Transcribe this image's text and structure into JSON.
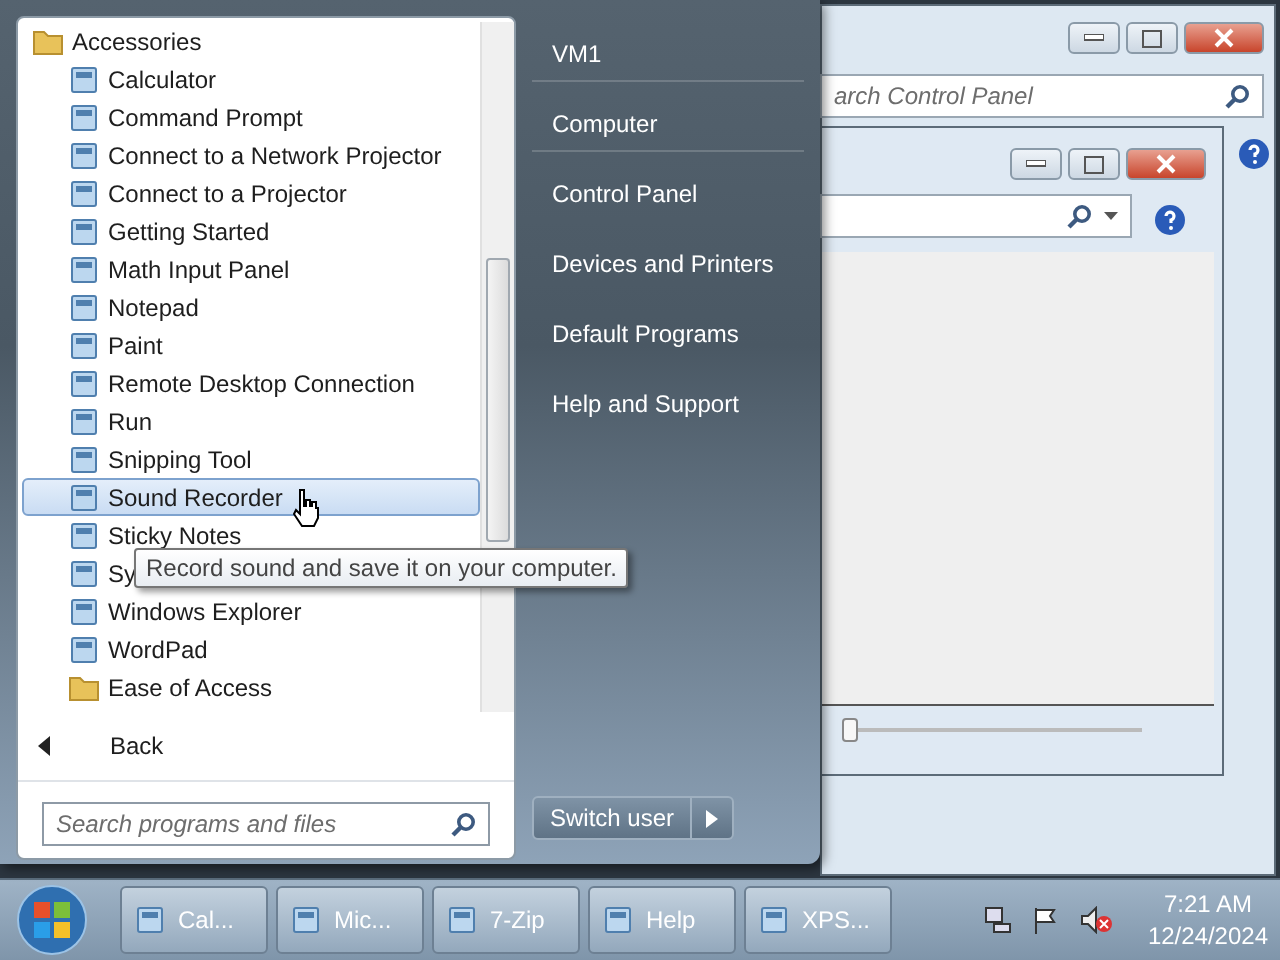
{
  "background_windows": {
    "outer": {
      "search": {
        "placeholder": "arch Control Panel"
      }
    },
    "inner": {
      "slider": {
        "level": 0
      }
    }
  },
  "start_menu": {
    "programs": [
      {
        "label": "Accessories",
        "kind": "folder",
        "selected": false,
        "children": [
          {
            "label": "Calculator",
            "kind": "app",
            "selected": false
          },
          {
            "label": "Command Prompt",
            "kind": "app",
            "selected": false
          },
          {
            "label": "Connect to a Network Projector",
            "kind": "app",
            "selected": false
          },
          {
            "label": "Connect to a Projector",
            "kind": "app",
            "selected": false
          },
          {
            "label": "Getting Started",
            "kind": "app",
            "selected": false
          },
          {
            "label": "Math Input Panel",
            "kind": "app",
            "selected": false
          },
          {
            "label": "Notepad",
            "kind": "app",
            "selected": false
          },
          {
            "label": "Paint",
            "kind": "app",
            "selected": false
          },
          {
            "label": "Remote Desktop Connection",
            "kind": "app",
            "selected": false
          },
          {
            "label": "Run",
            "kind": "app",
            "selected": false
          },
          {
            "label": "Snipping Tool",
            "kind": "app",
            "selected": false
          },
          {
            "label": "Sound Recorder",
            "kind": "app",
            "selected": true
          },
          {
            "label": "Sticky Notes",
            "kind": "app",
            "selected": false
          },
          {
            "label": "Sy",
            "kind": "app",
            "selected": false
          },
          {
            "label": "Windows Explorer",
            "kind": "app",
            "selected": false
          },
          {
            "label": "WordPad",
            "kind": "app",
            "selected": false
          },
          {
            "label": "Ease of Access",
            "kind": "folder",
            "selected": false
          }
        ]
      }
    ],
    "tooltip": "Record sound and save it on your computer.",
    "back": "Back",
    "search": {
      "placeholder": "Search programs and files"
    },
    "places": [
      {
        "label": "VM1",
        "separator_after": true
      },
      {
        "label": "Computer",
        "separator_after": true
      },
      {
        "label": "Control Panel",
        "separator_after": false
      },
      {
        "label": "Devices and Printers",
        "separator_after": false
      },
      {
        "label": "Default Programs",
        "separator_after": false
      },
      {
        "label": "Help and Support",
        "separator_after": false
      }
    ],
    "switch_user": "Switch user"
  },
  "taskbar": {
    "buttons": [
      {
        "label": "Cal..."
      },
      {
        "label": "Mic..."
      },
      {
        "label": "7-Zip"
      },
      {
        "label": "Help"
      },
      {
        "label": "XPS..."
      }
    ],
    "clock": {
      "time": "7:21 AM",
      "date": "12/24/2024"
    }
  }
}
